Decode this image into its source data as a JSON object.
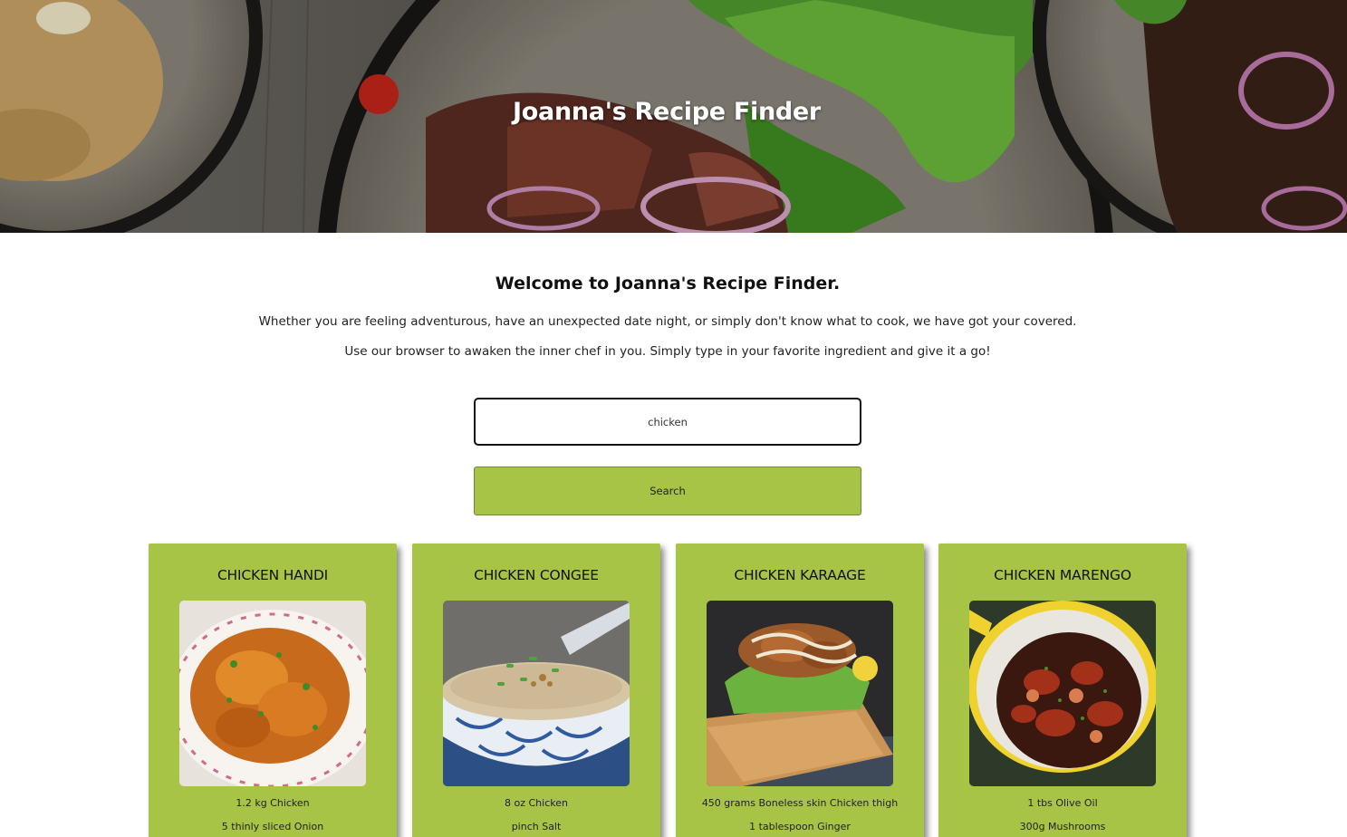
{
  "app": {
    "title": "Joanna's Recipe Finder"
  },
  "intro": {
    "heading": "Welcome to Joanna's Recipe Finder.",
    "paragraph1": "Whether you are feeling adventurous, have an unexpected date night, or simply don't know what to cook, we have got your covered.",
    "paragraph2": "Use our browser to awaken the inner chef in you. Simply type in your favorite ingredient and give it a go!"
  },
  "search": {
    "value": "chicken",
    "button_label": "Search"
  },
  "colors": {
    "accent_green": "#a8c446",
    "text": "#111111"
  },
  "recipes": [
    {
      "title": "CHICKEN HANDI",
      "image_icon": "chicken-curry-photo",
      "ingredients": [
        "1.2 kg Chicken",
        "5 thinly sliced Onion"
      ]
    },
    {
      "title": "CHICKEN CONGEE",
      "image_icon": "congee-bowl-photo",
      "ingredients": [
        "8 oz Chicken",
        "pinch Salt"
      ]
    },
    {
      "title": "CHICKEN KARAAGE",
      "image_icon": "karaage-plate-photo",
      "ingredients": [
        "450 grams Boneless skin Chicken thigh",
        "1 tablespoon Ginger"
      ]
    },
    {
      "title": "CHICKEN MARENGO",
      "image_icon": "marengo-pot-photo",
      "ingredients": [
        "1 tbs Olive Oil",
        "300g Mushrooms"
      ]
    }
  ]
}
